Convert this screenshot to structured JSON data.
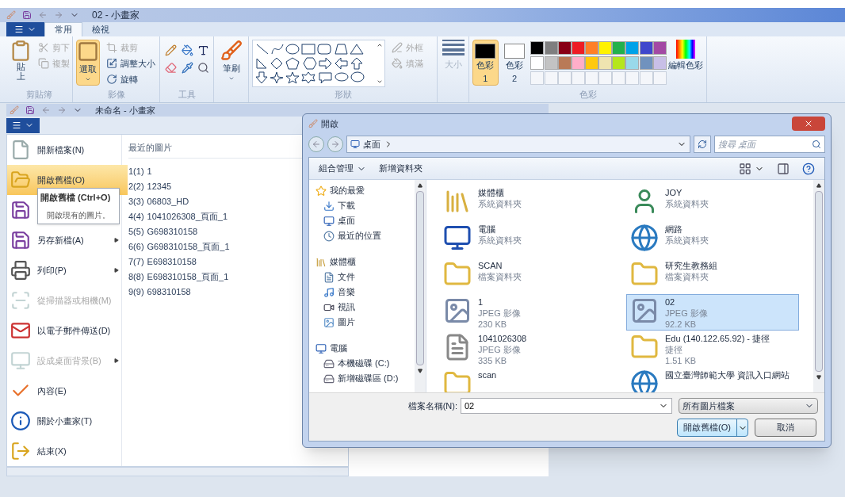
{
  "paint_window": {
    "title": "02 - 小畫家",
    "tabs": [
      {
        "label": "常用",
        "selected": true
      },
      {
        "label": "檢視",
        "selected": false
      }
    ],
    "clipboard": {
      "group_label": "剪貼簿",
      "paste": "貼上",
      "cut": {
        "label": "剪下",
        "disabled": true
      },
      "copy": {
        "label": "複製",
        "disabled": true
      }
    },
    "image": {
      "group_label": "影像",
      "select": {
        "label": "選取",
        "selected": true
      },
      "crop": {
        "label": "裁剪",
        "disabled": true
      },
      "resize": {
        "label": "調整大小",
        "disabled": false
      },
      "rotate": {
        "label": "旋轉",
        "disabled": false
      }
    },
    "tools": {
      "group_label": "工具"
    },
    "brushes": {
      "label": "筆刷"
    },
    "shapes": {
      "group_label": "形狀",
      "outline": {
        "label": "外框",
        "disabled": true
      },
      "fill": {
        "label": "填滿",
        "disabled": true
      }
    },
    "size": {
      "label": "大小",
      "disabled": true
    },
    "colors": {
      "group_label": "色彩",
      "color1": {
        "label": "色彩 1",
        "color": "#000000",
        "selected": true
      },
      "color2": {
        "label": "色彩 2",
        "color": "#ffffff",
        "selected": false
      },
      "palette": [
        {
          "kind": "color",
          "color": "#000000"
        },
        {
          "kind": "color",
          "color": "#7f7f7f"
        },
        {
          "kind": "color",
          "color": "#880015"
        },
        {
          "kind": "color",
          "color": "#ed1c24"
        },
        {
          "kind": "color",
          "color": "#ff7f27"
        },
        {
          "kind": "color",
          "color": "#fff200"
        },
        {
          "kind": "color",
          "color": "#22b14c"
        },
        {
          "kind": "color",
          "color": "#00a2e8"
        },
        {
          "kind": "color",
          "color": "#3f48cc"
        },
        {
          "kind": "color",
          "color": "#a349a4"
        },
        {
          "kind": "color",
          "color": "#ffffff"
        },
        {
          "kind": "color",
          "color": "#c3c3c3"
        },
        {
          "kind": "color",
          "color": "#b97a57"
        },
        {
          "kind": "color",
          "color": "#ffaec9"
        },
        {
          "kind": "color",
          "color": "#ffc90e"
        },
        {
          "kind": "color",
          "color": "#efe4b0"
        },
        {
          "kind": "color",
          "color": "#b5e61d"
        },
        {
          "kind": "color",
          "color": "#99d9ea"
        },
        {
          "kind": "color",
          "color": "#7092be"
        },
        {
          "kind": "color",
          "color": "#c8bfe7"
        },
        {
          "kind": "empty"
        },
        {
          "kind": "empty"
        },
        {
          "kind": "empty"
        },
        {
          "kind": "empty"
        },
        {
          "kind": "empty"
        },
        {
          "kind": "empty"
        },
        {
          "kind": "empty"
        },
        {
          "kind": "empty"
        },
        {
          "kind": "empty"
        },
        {
          "kind": "empty"
        }
      ],
      "edit": "編輯色彩"
    }
  },
  "app_window": {
    "title": "未命名 - 小畫家",
    "menu_items": [
      {
        "kind": "new",
        "label": "開新檔案(N)",
        "selected": false,
        "disabled": false,
        "submenu": false
      },
      {
        "kind": "open",
        "label": "開啟舊檔(O)",
        "selected": true,
        "disabled": false,
        "submenu": false
      },
      {
        "kind": "save",
        "selected": false,
        "disabled": false
      },
      {
        "kind": "saveas",
        "label": "另存新檔(A)",
        "selected": false,
        "disabled": false,
        "submenu": true
      },
      {
        "kind": "print",
        "label": "列印(P)",
        "selected": false,
        "disabled": false,
        "submenu": true
      },
      {
        "kind": "scan",
        "label": "從掃描器或相機(M)",
        "selected": false,
        "disabled": true,
        "submenu": false
      },
      {
        "kind": "email",
        "label": "以電子郵件傳送(D)",
        "selected": false,
        "disabled": false,
        "submenu": false
      },
      {
        "kind": "desktop",
        "label": "設成桌面背景(B)",
        "selected": false,
        "disabled": true,
        "submenu": true
      },
      {
        "kind": "properties",
        "label": "內容(E)",
        "selected": false,
        "disabled": false,
        "submenu": false
      },
      {
        "kind": "about",
        "label": "關於小畫家(T)",
        "selected": false,
        "disabled": false,
        "submenu": false
      },
      {
        "kind": "exit",
        "label": "結束(X)",
        "selected": false,
        "disabled": false,
        "submenu": false
      }
    ],
    "recent": {
      "heading": "最近的圖片",
      "items": [
        {
          "number": "1(1)",
          "name": "1"
        },
        {
          "number": "2(2)",
          "name": "12345"
        },
        {
          "number": "3(3)",
          "name": "06803_HD"
        },
        {
          "number": "4(4)",
          "name": "1041026308_頁面_1"
        },
        {
          "number": "5(5)",
          "name": "G698310158"
        },
        {
          "number": "6(6)",
          "name": "G698310158_頁面_1"
        },
        {
          "number": "7(7)",
          "name": "E698310158"
        },
        {
          "number": "8(8)",
          "name": "E698310158_頁面_1"
        },
        {
          "number": "9(9)",
          "name": "698310158"
        }
      ]
    },
    "tooltip": {
      "title": "開啟舊檔 (Ctrl+O)",
      "text": "開啟現有的圖片。"
    }
  },
  "open_dialog": {
    "title": "開啟",
    "location": "桌面",
    "search": {
      "placeholder": "搜尋 桌面"
    },
    "toolbar": [
      {
        "label": "組合管理",
        "dropdown": true
      },
      {
        "label": "新增資料夾",
        "dropdown": false
      }
    ],
    "nav": [
      {
        "kind": "favorites",
        "label": "我的最愛",
        "children": [
          {
            "kind": "downloads",
            "label": "下載"
          },
          {
            "kind": "desktop",
            "label": "桌面"
          },
          {
            "kind": "recent",
            "label": "最近的位置"
          }
        ]
      },
      {
        "kind": "libraries",
        "label": "媒體櫃",
        "children": [
          {
            "kind": "documents",
            "label": "文件"
          },
          {
            "kind": "music",
            "label": "音樂"
          },
          {
            "kind": "videos",
            "label": "視訊"
          },
          {
            "kind": "pictures",
            "label": "圖片"
          }
        ]
      },
      {
        "kind": "computer",
        "label": "電腦",
        "children": [
          {
            "kind": "drive",
            "label": "本機磁碟 (C:)"
          },
          {
            "kind": "drive",
            "label": "新增磁碟區 (D:)"
          }
        ]
      }
    ],
    "files": [
      {
        "kind": "library",
        "name": "媒體櫃",
        "type": "系統資料夾",
        "selected": false
      },
      {
        "kind": "user",
        "name": "JOY",
        "type": "系統資料夾",
        "selected": false
      },
      {
        "kind": "computer",
        "name": "電腦",
        "type": "系統資料夾",
        "selected": false
      },
      {
        "kind": "network",
        "name": "網路",
        "type": "系統資料夾",
        "selected": false
      },
      {
        "kind": "folder",
        "name": "SCAN",
        "type": "檔案資料夾",
        "selected": false
      },
      {
        "kind": "folder",
        "name": "研究生教務組",
        "type": "檔案資料夾",
        "selected": false
      },
      {
        "kind": "image",
        "name": "1",
        "type": "JPEG 影像",
        "size": "230 KB",
        "selected": false
      },
      {
        "kind": "image",
        "name": "02",
        "type": "JPEG 影像",
        "size": "92.2 KB",
        "selected": true
      },
      {
        "kind": "document",
        "name": "1041026308",
        "type": "JPEG 影像",
        "size": "335 KB",
        "selected": false
      },
      {
        "kind": "shortcut",
        "name": "Edu (140.122.65.92) - 捷徑",
        "type": "捷徑",
        "size": "1.51 KB",
        "selected": false
      },
      {
        "kind": "folder",
        "name": "scan",
        "selected": false
      },
      {
        "kind": "web",
        "name": "國立臺灣師範大學 資訊入口網站",
        "selected": false
      }
    ],
    "file_name": {
      "label": "檔案名稱(N):",
      "value": "02"
    },
    "file_type": "所有圖片檔案",
    "open_button": "開啟舊檔(O)",
    "cancel_button": "取消"
  }
}
